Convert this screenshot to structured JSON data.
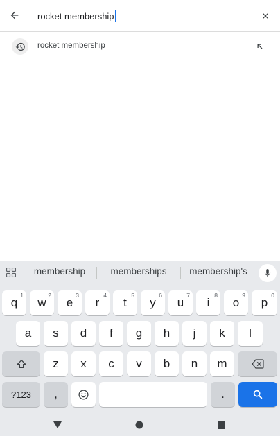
{
  "search": {
    "query": "rocket membership"
  },
  "suggestions": [
    {
      "text": "rocket membership",
      "icon": "history-icon",
      "action_icon": "insert-arrow-icon"
    }
  ],
  "keyboard": {
    "suggestion_words": [
      "membership",
      "memberships",
      "membership's"
    ],
    "row1": [
      {
        "label": "q",
        "hint": "1"
      },
      {
        "label": "w",
        "hint": "2"
      },
      {
        "label": "e",
        "hint": "3"
      },
      {
        "label": "r",
        "hint": "4"
      },
      {
        "label": "t",
        "hint": "5"
      },
      {
        "label": "y",
        "hint": "6"
      },
      {
        "label": "u",
        "hint": "7"
      },
      {
        "label": "i",
        "hint": "8"
      },
      {
        "label": "o",
        "hint": "9"
      },
      {
        "label": "p",
        "hint": "0"
      }
    ],
    "row2": [
      "a",
      "s",
      "d",
      "f",
      "g",
      "h",
      "j",
      "k",
      "l"
    ],
    "row3": [
      "z",
      "x",
      "c",
      "v",
      "b",
      "n",
      "m"
    ],
    "symbols_label": "?123",
    "comma_label": ",",
    "period_label": "."
  },
  "colors": {
    "accent": "#1a73e8",
    "keyboard_bg": "#e8eaed",
    "key_bg": "#ffffff",
    "key_dark_bg": "#d1d4d8"
  }
}
